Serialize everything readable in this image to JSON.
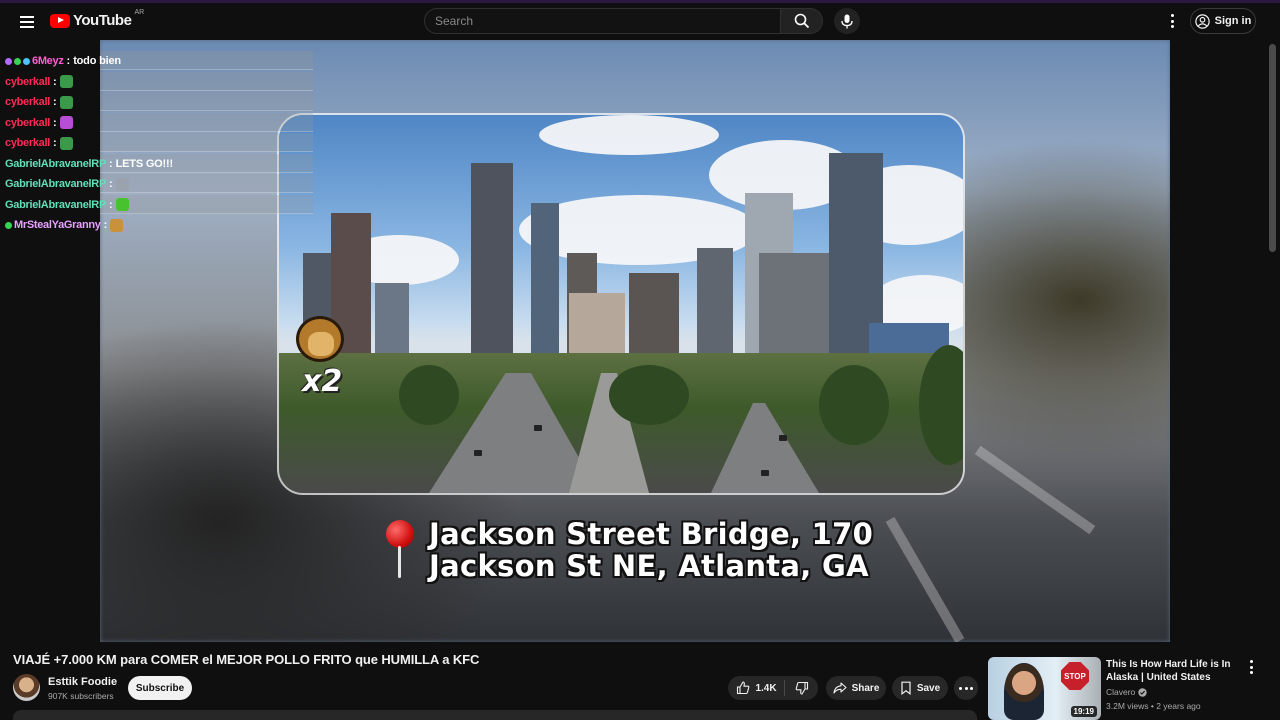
{
  "header": {
    "logo_text": "YouTube",
    "logo_country": "AR",
    "search_placeholder": "Search",
    "signin_label": "Sign in"
  },
  "chat": {
    "messages": [
      {
        "user": "6Meyz",
        "color": "#ff5fd2",
        "text": "todo bien",
        "badges": [
          "#b36bff",
          "#39d353",
          "#4fc3f7"
        ],
        "emote": ""
      },
      {
        "user": "cyberkall",
        "color": "#ff2a55",
        "text": "",
        "emote": "#3a9a4a"
      },
      {
        "user": "cyberkall",
        "color": "#ff2a55",
        "text": "",
        "emote": "#3a9a4a"
      },
      {
        "user": "cyberkall",
        "color": "#ff2a55",
        "text": "",
        "emote": "#b74fd6"
      },
      {
        "user": "cyberkall",
        "color": "#ff2a55",
        "text": "",
        "emote": "#3a9a4a"
      },
      {
        "user": "GabrielAbravanelRP",
        "color": "#5fe0b8",
        "text": "LETS GO!!!",
        "emote": ""
      },
      {
        "user": "GabrielAbravanelRP",
        "color": "#5fe0b8",
        "text": "",
        "emote": "#9aa2ad"
      },
      {
        "user": "GabrielAbravanelRP",
        "color": "#5fe0b8",
        "text": "",
        "emote": "#49c230"
      },
      {
        "user": "MrStealYaGranny",
        "color": "#e6a0ff",
        "text": "",
        "badges": [
          "#39d353"
        ],
        "emote": "#c8913a"
      }
    ]
  },
  "video": {
    "location_line1": "Jackson Street Bridge, 170",
    "location_line2": "Jackson St NE, Atlanta, GA",
    "multiplier": "x2",
    "title": "VIAJÉ +7.000 KM para COMER el MEJOR POLLO FRITO que HUMILLA a KFC",
    "channel": "Esttik Foodie",
    "subscribers": "907K subscribers",
    "subscribe_label": "Subscribe",
    "likes": "1.4K",
    "share_label": "Share",
    "save_label": "Save"
  },
  "recommendation": {
    "title": "This Is How Hard Life is In Alaska | United States",
    "channel": "Clavero",
    "views": "3.2M views",
    "age": "2 years ago",
    "meta": "3.2M views • 2 years ago",
    "duration": "19:19",
    "thumb_sign": "STOP"
  }
}
